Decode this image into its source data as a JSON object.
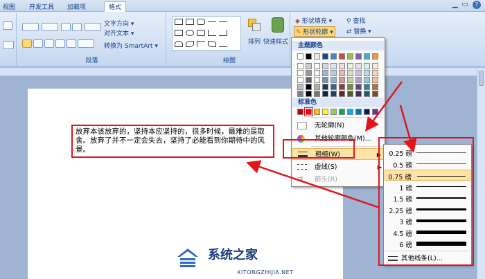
{
  "tabs": [
    "视图",
    "开发工具",
    "加载项",
    "格式"
  ],
  "ribbon": {
    "paragraph": {
      "text_direction": "文字方向",
      "align_text": "对齐文本",
      "convert_smartart": "转换为 SmartArt",
      "label": "段落"
    },
    "drawing": {
      "arrange": "排列",
      "quick_styles": "快速样式",
      "shape_fill": "形状填充",
      "shape_outline": "形状轮廓",
      "label": "绘图"
    },
    "editing": {
      "find": "查找",
      "replace": "替换"
    }
  },
  "document": {
    "textbox_text": "放弃本该放弃的，坚持本应坚持的，很多时候，最难的是取舍。放弃了并不一定会失去，坚持了必能看到你期待中的风景。"
  },
  "outline_menu": {
    "theme_colors_header": "主题颜色",
    "standard_colors_header": "标准色",
    "no_outline": "无轮廓(N)",
    "more_colors": "其他轮廓颜色(M)...",
    "weight": "粗细(W)",
    "dashes": "虚线(S)",
    "arrows": "箭头(R)",
    "theme_colors": [
      "#ffffff",
      "#000000",
      "#eeece1",
      "#1f497d",
      "#4f81bd",
      "#c0504d",
      "#9bbb59",
      "#8064a2",
      "#4bacc6",
      "#f79646"
    ],
    "standard_colors": [
      "#c00000",
      "#ff0000",
      "#ffc000",
      "#ffff00",
      "#92d050",
      "#00b050",
      "#00b0f0",
      "#0070c0",
      "#002060",
      "#7030a0"
    ]
  },
  "weight_menu": {
    "items": [
      {
        "label": "0.25 磅",
        "w": 0.25
      },
      {
        "label": "0.5 磅",
        "w": 0.5
      },
      {
        "label": "0.75 磅",
        "w": 0.75,
        "selected": true
      },
      {
        "label": "1 磅",
        "w": 1
      },
      {
        "label": "1.5 磅",
        "w": 1.5
      },
      {
        "label": "2.25 磅",
        "w": 2.25
      },
      {
        "label": "3 磅",
        "w": 3
      },
      {
        "label": "4.5 磅",
        "w": 4.5
      },
      {
        "label": "6 磅",
        "w": 6
      }
    ],
    "more_lines": "其他线条(L)..."
  },
  "watermark": {
    "title": "系统之家",
    "url": "XITONGZHIJIA.NET"
  },
  "colors": {
    "annotation_red": "#e4141b",
    "highlight": "#fce4a8"
  }
}
